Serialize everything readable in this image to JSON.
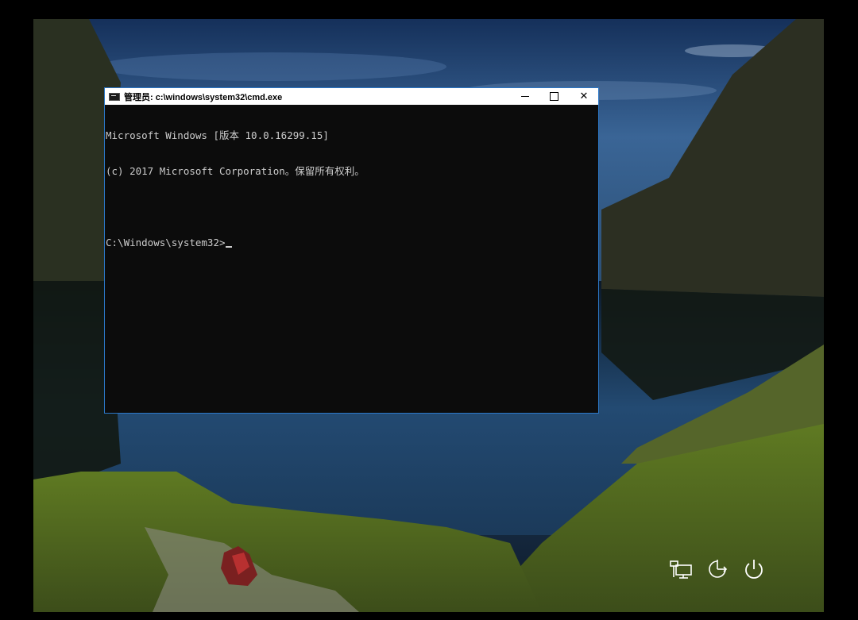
{
  "cmd_window": {
    "title": "管理员: c:\\windows\\system32\\cmd.exe",
    "minimize_label": "",
    "maximize_label": "",
    "close_label": "✕",
    "lines": [
      "Microsoft Windows [版本 10.0.16299.15]",
      "(c) 2017 Microsoft Corporation。保留所有权利。",
      "",
      "C:\\Windows\\system32>"
    ]
  },
  "system_icons": [
    {
      "name": "network-icon"
    },
    {
      "name": "ease-of-access-icon"
    },
    {
      "name": "power-icon"
    }
  ],
  "colors": {
    "window_border": "#2b77c7",
    "console_background": "#0c0c0c",
    "console_text": "#cccccc"
  }
}
